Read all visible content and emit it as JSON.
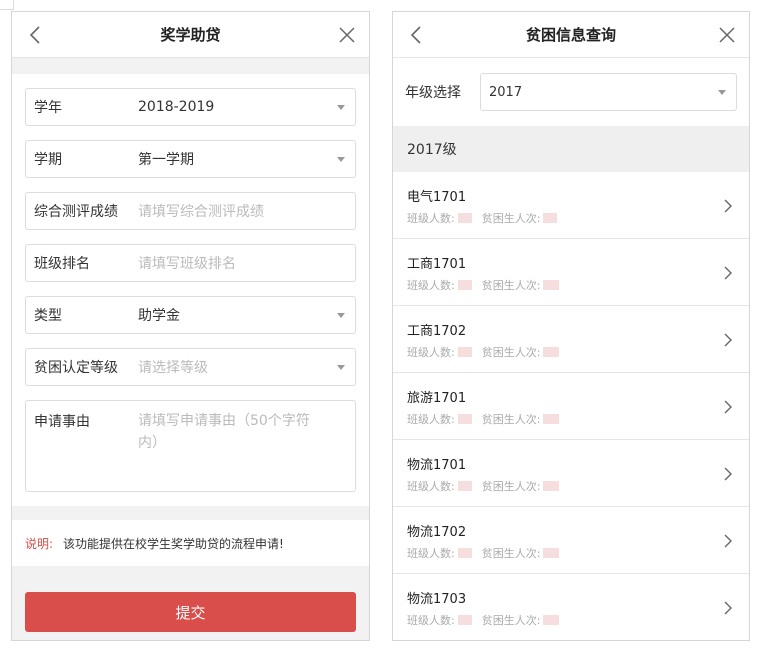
{
  "left": {
    "title": "奖学助贷",
    "fields": [
      {
        "label": "学年",
        "value": "2018-2019",
        "placeholder": ""
      },
      {
        "label": "学期",
        "value": "第一学期",
        "placeholder": ""
      },
      {
        "label": "综合测评成绩",
        "value": "",
        "placeholder": "请填写综合测评成绩"
      },
      {
        "label": "班级排名",
        "value": "",
        "placeholder": "请填写班级排名"
      },
      {
        "label": "类型",
        "value": "助学金",
        "placeholder": ""
      },
      {
        "label": "贫困认定等级",
        "value": "",
        "placeholder": "请选择等级"
      },
      {
        "label": "申请事由",
        "value": "",
        "placeholder": "请填写申请事由（50个字符内）"
      }
    ],
    "note_key": "说明:",
    "note_text": "该功能提供在校学生奖学助贷的流程申请!",
    "submit_label": "提交"
  },
  "right": {
    "title": "贫困信息查询",
    "grade_label": "年级选择",
    "grade_value": "2017",
    "group_header": "2017级",
    "meta_class_count": "班级人数:",
    "meta_poor_count": "贫困生人次:",
    "classes": [
      "电气1701",
      "工商1701",
      "工商1702",
      "旅游1701",
      "物流1701",
      "物流1702",
      "物流1703"
    ]
  },
  "colors": {
    "accent": "#d94d4b",
    "band": "#f2f2f2"
  }
}
